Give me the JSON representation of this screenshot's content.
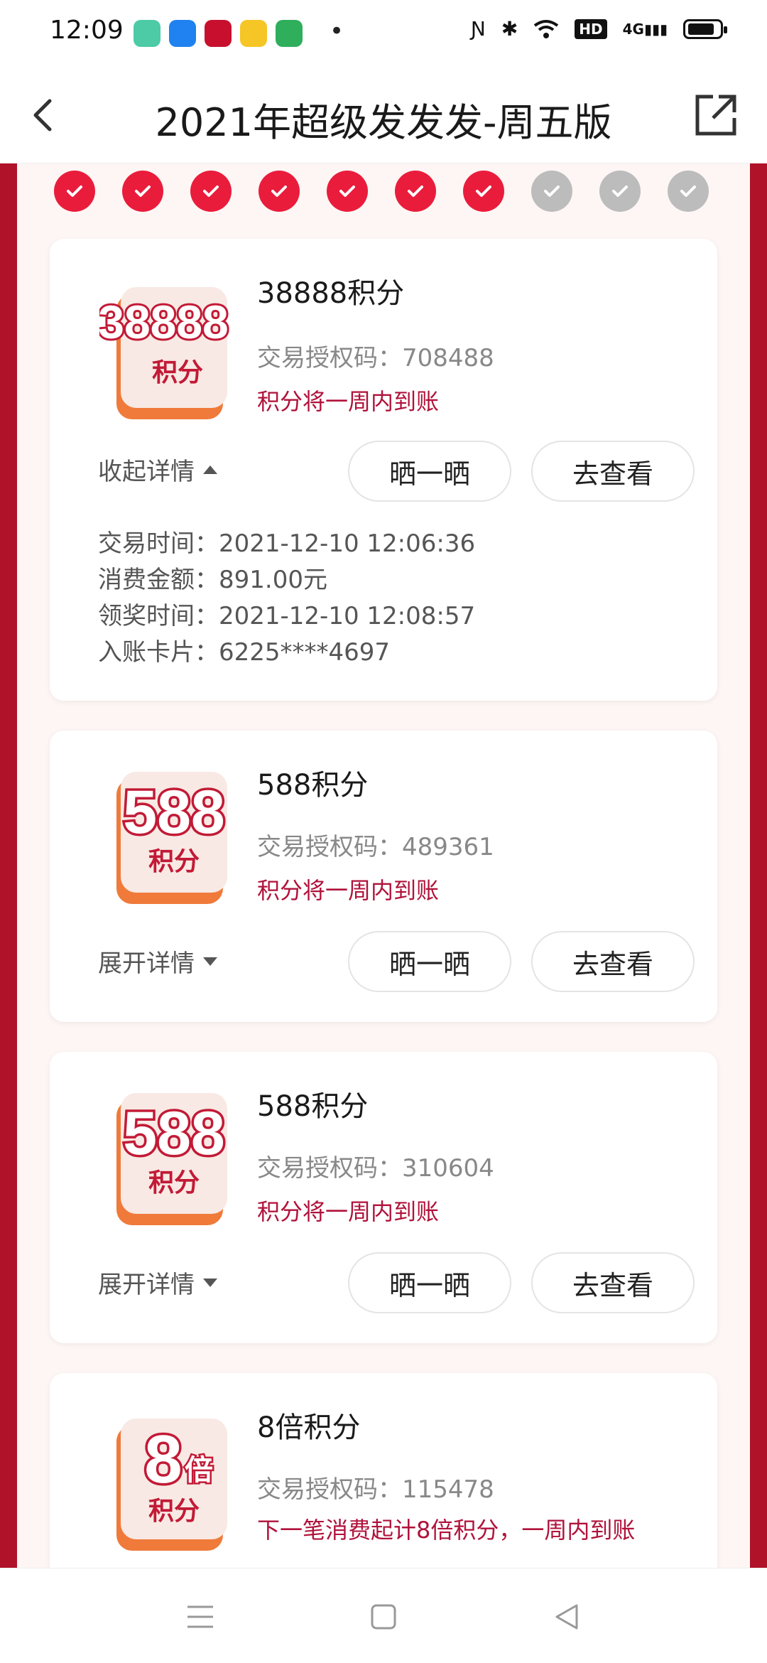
{
  "status_bar": {
    "time": "12:09",
    "network": "4G",
    "hd": "HD",
    "apps": [
      "#4ccba6",
      "#1f82f0",
      "#c8102e",
      "#f6c626",
      "#2fae5c"
    ]
  },
  "header": {
    "title": "2021年超级发发发-周五版"
  },
  "progress": {
    "done_count": 7,
    "total": 10,
    "done_color": "#ea1c3c",
    "todo_color": "#bcbcbc"
  },
  "cards": [
    {
      "tile_big": "38888",
      "tile_sub": "积分",
      "title": "38888积分",
      "auth_label": "交易授权码：",
      "auth_code": "708488",
      "note": "积分将一周内到账",
      "toggle_label": "收起详情",
      "share_label": "晒一晒",
      "view_label": "去查看",
      "details": {
        "time": "交易时间：2021-12-10 12:06:36",
        "amount": "消费金额：891.00元",
        "award_time": "领奖时间：2021-12-10 12:08:57",
        "card": "入账卡片：6225****4697"
      }
    },
    {
      "tile_big": "588",
      "tile_sub": "积分",
      "title": "588积分",
      "auth_label": "交易授权码：",
      "auth_code": "489361",
      "note": "积分将一周内到账",
      "toggle_label": "展开详情",
      "share_label": "晒一晒",
      "view_label": "去查看"
    },
    {
      "tile_big": "588",
      "tile_sub": "积分",
      "title": "588积分",
      "auth_label": "交易授权码：",
      "auth_code": "310604",
      "note": "积分将一周内到账",
      "toggle_label": "展开详情",
      "share_label": "晒一晒",
      "view_label": "去查看"
    },
    {
      "tile_big": "8",
      "tile_small": "倍",
      "tile_sub": "积分",
      "title": "8倍积分",
      "auth_label": "交易授权码：",
      "auth_code": "115478",
      "note": "下一笔消费起计8倍积分，一周内到账"
    }
  ],
  "colors": {
    "brand_red": "#b01229",
    "accent_red": "#ea1c3c",
    "note_red": "#b0123a"
  }
}
